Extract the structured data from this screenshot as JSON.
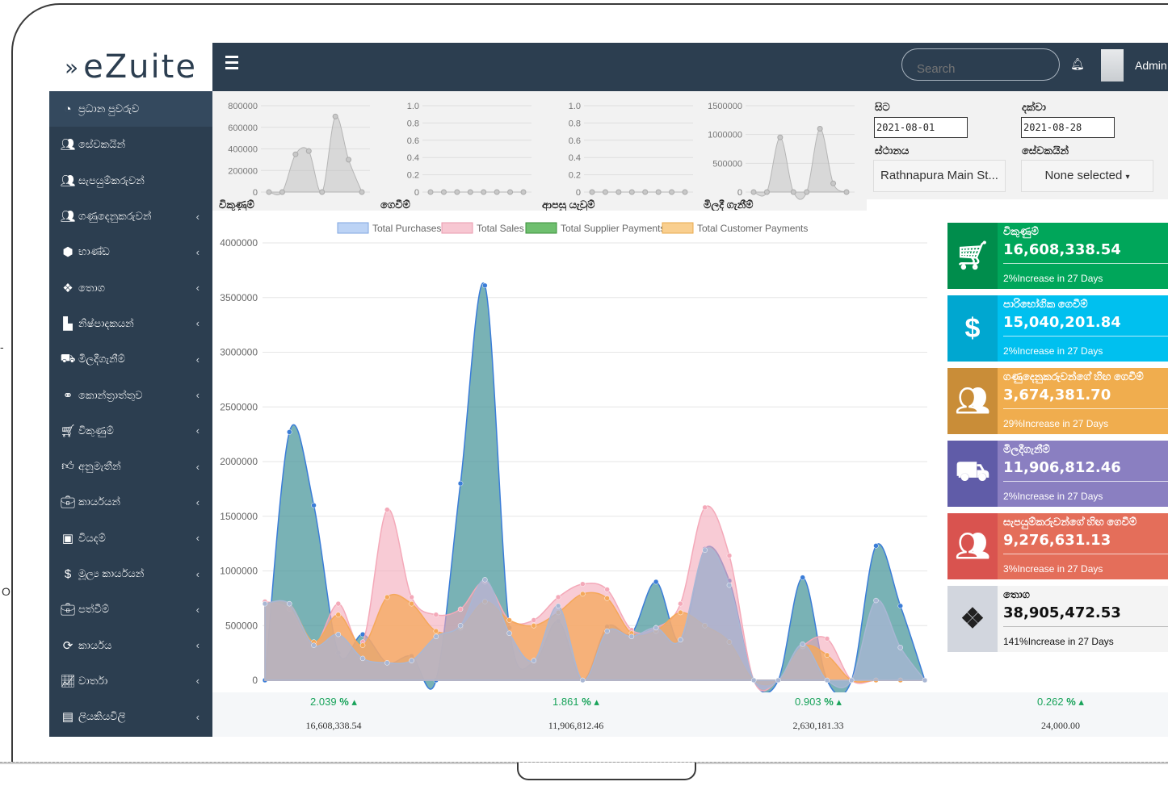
{
  "app": {
    "logo_text": "eZuite",
    "logo_mark": "»"
  },
  "topbar": {
    "search_placeholder": "Search",
    "user_name": "Admin"
  },
  "sidebar": {
    "items": [
      {
        "label": "ප්‍රධාන පුවරුව",
        "icon": "dashboard-icon",
        "has_children": false
      },
      {
        "label": "සේවකයින්",
        "icon": "users-icon",
        "has_children": false
      },
      {
        "label": "සැපයුම්කරුවන්",
        "icon": "users-icon",
        "has_children": false
      },
      {
        "label": "ගණුදෙනුකරුවන්",
        "icon": "users-icon",
        "has_children": true
      },
      {
        "label": "භාණ්ඩ",
        "icon": "cube-icon",
        "has_children": true
      },
      {
        "label": "තොග",
        "icon": "cubes-icon",
        "has_children": true
      },
      {
        "label": "නිෂ්පාදකයන්",
        "icon": "industry-icon",
        "has_children": true
      },
      {
        "label": "මිලදීගැනීම්",
        "icon": "truck-icon",
        "has_children": true
      },
      {
        "label": "කොන්ත්‍රාත්තුව",
        "icon": "handshake-icon",
        "has_children": true
      },
      {
        "label": "විකුණුම්",
        "icon": "cart-icon",
        "has_children": true
      },
      {
        "label": "අනුමැතීන්",
        "icon": "thumbs-up-icon",
        "has_children": true
      },
      {
        "label": "කාර්යයන්",
        "icon": "briefcase-icon",
        "has_children": true
      },
      {
        "label": "වියදම්",
        "icon": "money-icon",
        "has_children": true
      },
      {
        "label": "මූල්‍ය කාර්යයන්",
        "icon": "dollar-icon",
        "has_children": true
      },
      {
        "label": "පත්වීම්",
        "icon": "briefcase-icon",
        "has_children": true
      },
      {
        "label": "කාර්යය",
        "icon": "refresh-icon",
        "has_children": true
      },
      {
        "label": "වාර්තා",
        "icon": "line-chart-icon",
        "has_children": true
      },
      {
        "label": "ලියකියවිලි",
        "icon": "document-icon",
        "has_children": true
      }
    ]
  },
  "filters": {
    "from_label": "සිට",
    "from_value": "2021-08-01",
    "to_label": "දක්වා",
    "to_value": "2021-08-28",
    "location_label": "ස්ථානය",
    "location_value": "Rathnapura Main St...",
    "employees_label": "සේවකයින්",
    "employees_value": "None selected"
  },
  "chart_data": [
    {
      "type": "area",
      "title": "විකුණුම්",
      "yticks": [
        0,
        200000,
        400000,
        600000,
        800000
      ],
      "ylim": [
        0,
        800000
      ],
      "values": [
        0,
        0,
        350000,
        380000,
        0,
        700000,
        300000,
        0
      ]
    },
    {
      "type": "area",
      "title": "ගෙවීම්",
      "yticks": [
        0,
        0.2,
        0.4,
        0.6,
        0.8,
        1.0
      ],
      "ylim": [
        0,
        1.0
      ],
      "values": [
        0,
        0,
        0,
        0,
        0,
        0,
        0,
        0
      ]
    },
    {
      "type": "area",
      "title": "ආපසු යැවුම්",
      "yticks": [
        0,
        0.2,
        0.4,
        0.6,
        0.8,
        1.0
      ],
      "ylim": [
        0,
        1.0
      ],
      "values": [
        0,
        0,
        0,
        0,
        0,
        0,
        0,
        0
      ]
    },
    {
      "type": "area",
      "title": "මිලදී ගැනීම්",
      "yticks": [
        0,
        500000,
        1000000,
        1500000
      ],
      "ylim": [
        0,
        1500000
      ],
      "values": [
        0,
        0,
        950000,
        0,
        0,
        1100000,
        150000,
        0
      ]
    },
    {
      "type": "area",
      "title": "",
      "yticks": [
        0,
        500000,
        1000000,
        1500000,
        2000000,
        2500000,
        3000000,
        3500000,
        4000000
      ],
      "ylim": [
        0,
        4000000
      ],
      "legend": [
        "Total Purchases",
        "Total Sales",
        "Total Supplier Payments",
        "Total Customer Payments"
      ],
      "series": [
        {
          "name": "Total Supplier Payments",
          "color": "#4e9aa0",
          "values": [
            0,
            2270000,
            1600000,
            250000,
            420000,
            160000,
            220000,
            0,
            1800000,
            3610000,
            480000,
            160000,
            540000,
            0,
            490000,
            430000,
            900000,
            350000,
            1200000,
            910000,
            0,
            0,
            940000,
            0,
            0,
            1230000,
            680000,
            0
          ]
        },
        {
          "name": "Total Sales",
          "color": "#f4a9b9",
          "values": [
            720000,
            650000,
            320000,
            700000,
            350000,
            1560000,
            760000,
            600000,
            650000,
            900000,
            550000,
            550000,
            760000,
            880000,
            830000,
            460000,
            480000,
            700000,
            1580000,
            1140000,
            0,
            0,
            310000,
            380000,
            0,
            0,
            0,
            0
          ]
        },
        {
          "name": "Total Customer Payments",
          "color": "#f5b26b",
          "values": [
            700000,
            700000,
            350000,
            600000,
            320000,
            760000,
            700000,
            450000,
            480000,
            720000,
            550000,
            500000,
            620000,
            790000,
            750000,
            430000,
            450000,
            620000,
            500000,
            350000,
            0,
            0,
            310000,
            230000,
            0,
            0,
            0,
            0
          ]
        },
        {
          "name": "Total Purchases",
          "color": "#a9b7d4",
          "values": [
            700000,
            700000,
            320000,
            420000,
            200000,
            160000,
            180000,
            400000,
            500000,
            920000,
            430000,
            180000,
            680000,
            0,
            450000,
            400000,
            480000,
            370000,
            1190000,
            870000,
            0,
            0,
            330000,
            0,
            0,
            730000,
            300000,
            0
          ]
        }
      ]
    }
  ],
  "cards": [
    {
      "title": "විකුණුම්",
      "value": "16,608,338.54",
      "increase": "2%Increase in 27 Days",
      "color": "#00a65a",
      "icon_color": "#008d4c",
      "icon": "cart-icon"
    },
    {
      "title": "පාරිභෝගික ගෙවීම්",
      "value": "15,040,201.84",
      "increase": "2%Increase in 27 Days",
      "color": "#00c0ef",
      "icon_color": "#00a7d0",
      "icon": "dollar-icon"
    },
    {
      "title": "ගණුදෙනුකරුවන්ගේ හිඟ ගෙවීම්",
      "value": "3,674,381.70",
      "increase": "29%Increase in 27 Days",
      "color": "#f0ad4e",
      "icon_color": "#c98d38",
      "icon": "users-icon"
    },
    {
      "title": "මිලදීගැනීම්",
      "value": "11,906,812.46",
      "increase": "2%Increase in 27 Days",
      "color": "#8a7fc1",
      "icon_color": "#605ca8",
      "icon": "truck-icon"
    },
    {
      "title": "සැපයුම්කරුවන්ගේ හිඟ ගෙවීම්",
      "value": "9,276,631.13",
      "increase": "3%Increase in 27 Days",
      "color": "#e46e5a",
      "icon_color": "#d9534f",
      "icon": "users-icon"
    },
    {
      "title": "තොග",
      "value": "38,905,472.53",
      "increase": "141%Increase in 27 Days",
      "color": "#f4f4f4",
      "icon_color": "#d2d6de",
      "icon": "cubes-icon"
    }
  ],
  "footer": [
    {
      "pct": "2.039",
      "amount": "16,608,338.54"
    },
    {
      "pct": "1.861",
      "amount": "11,906,812.46"
    },
    {
      "pct": "0.903",
      "amount": "2,630,181.33"
    },
    {
      "pct": "0.262",
      "amount": "24,000.00"
    }
  ],
  "edge_marks": [
    "-",
    "O"
  ]
}
